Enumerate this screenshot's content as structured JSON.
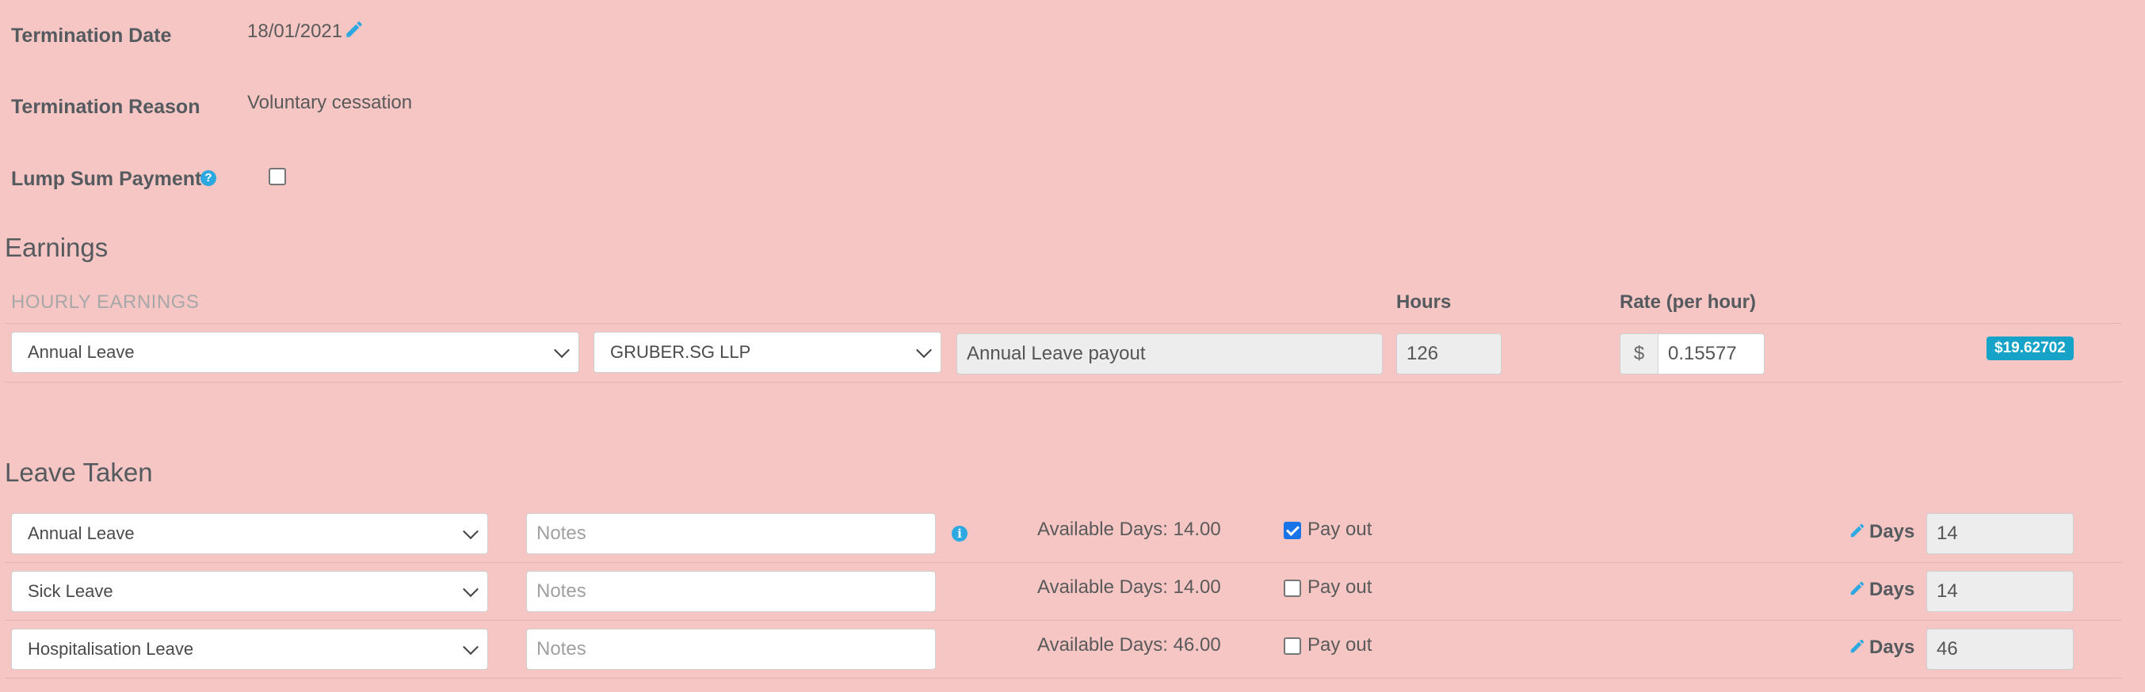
{
  "termination": {
    "date_label": "Termination Date",
    "date_value": "18/01/2021",
    "reason_label": "Termination Reason",
    "reason_value": "Voluntary cessation",
    "lump_sum_label": "Lump Sum Payments",
    "lump_sum_checked": false
  },
  "earnings": {
    "title": "Earnings",
    "subheading": "HOURLY EARNINGS",
    "hours_header": "Hours",
    "rate_header": "Rate (per hour)",
    "row": {
      "earning_type": "Annual Leave",
      "company": "GRUBER.SG LLP",
      "description": "Annual Leave payout",
      "hours": "126",
      "currency": "$",
      "rate": "0.15577",
      "total": "$19.62702"
    }
  },
  "leave": {
    "title": "Leave Taken",
    "notes_placeholder": "Notes",
    "payout_label": "Pay out",
    "days_label": "Days",
    "rows": [
      {
        "type": "Annual Leave",
        "available": "Available Days: 14.00",
        "payout": true,
        "days": "14"
      },
      {
        "type": "Sick Leave",
        "available": "Available Days: 14.00",
        "payout": false,
        "days": "14"
      },
      {
        "type": "Hospitalisation Leave",
        "available": "Available Days: 46.00",
        "payout": false,
        "days": "46"
      }
    ]
  },
  "colors": {
    "background": "#f5c6c4",
    "accent": "#2ea8e0",
    "badge": "#17a2c8",
    "checkbox_checked": "#1a73e8"
  },
  "icons": {
    "edit": "pencil-icon",
    "help": "question-circle-icon",
    "info": "info-circle-icon",
    "dropdown": "chevron-down-icon"
  }
}
